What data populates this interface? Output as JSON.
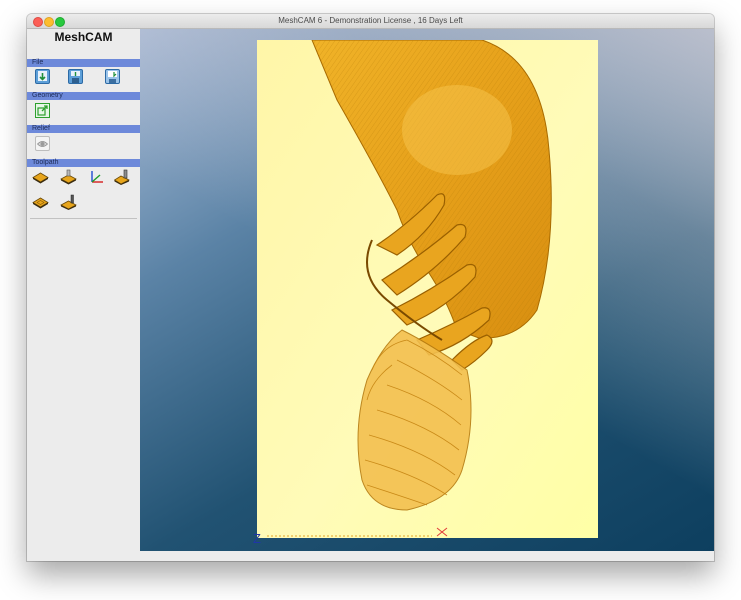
{
  "window": {
    "title": "MeshCAM 6 - Demonstration License  , 16 Days Left"
  },
  "sidebar": {
    "app_name": "MeshCAM",
    "sections": {
      "file": {
        "label": "File",
        "tools": [
          "open-geometry-icon",
          "save-job-icon",
          "save-gcode-icon"
        ]
      },
      "geometry": {
        "label": "Geometry",
        "tools": [
          "resize-geometry-icon"
        ]
      },
      "relief": {
        "label": "Relief",
        "tools": [
          "relief-icon"
        ]
      },
      "toolpath": {
        "label": "Toolpath",
        "tools": [
          "stock-setup-icon",
          "machining-region-icon",
          "set-origin-icon",
          "tool-library-icon",
          "calculate-toolpath-icon",
          "simulate-toolpath-icon"
        ]
      }
    }
  },
  "viewport": {
    "axis_label": "Z",
    "model_color": "#e8a51e",
    "stock_color": "#fffb9e"
  }
}
